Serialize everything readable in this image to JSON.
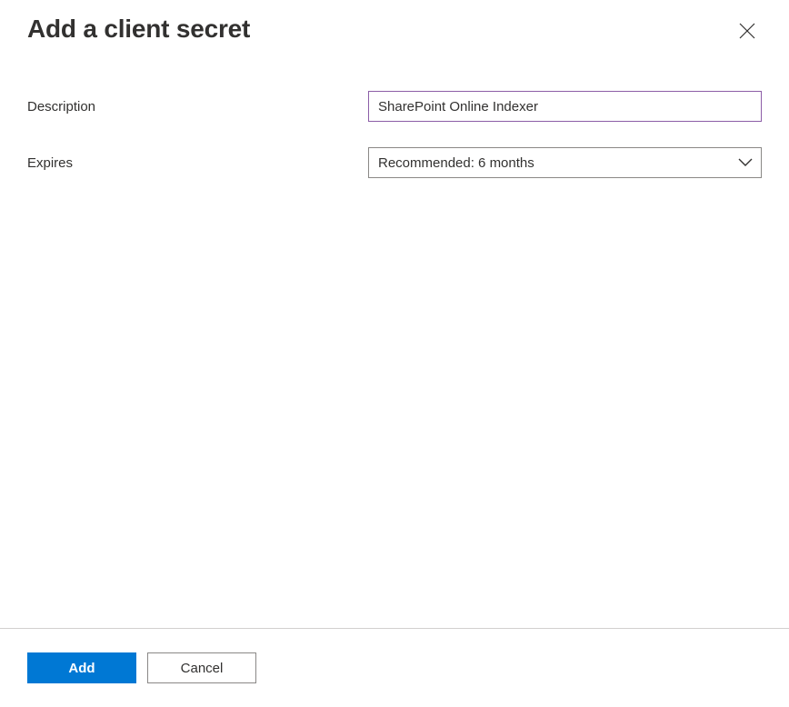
{
  "header": {
    "title": "Add a client secret"
  },
  "form": {
    "description": {
      "label": "Description",
      "value": "SharePoint Online Indexer"
    },
    "expires": {
      "label": "Expires",
      "selected": "Recommended: 6 months"
    }
  },
  "footer": {
    "add_label": "Add",
    "cancel_label": "Cancel"
  },
  "icons": {
    "close": "close-icon",
    "chevron_down": "chevron-down-icon"
  }
}
